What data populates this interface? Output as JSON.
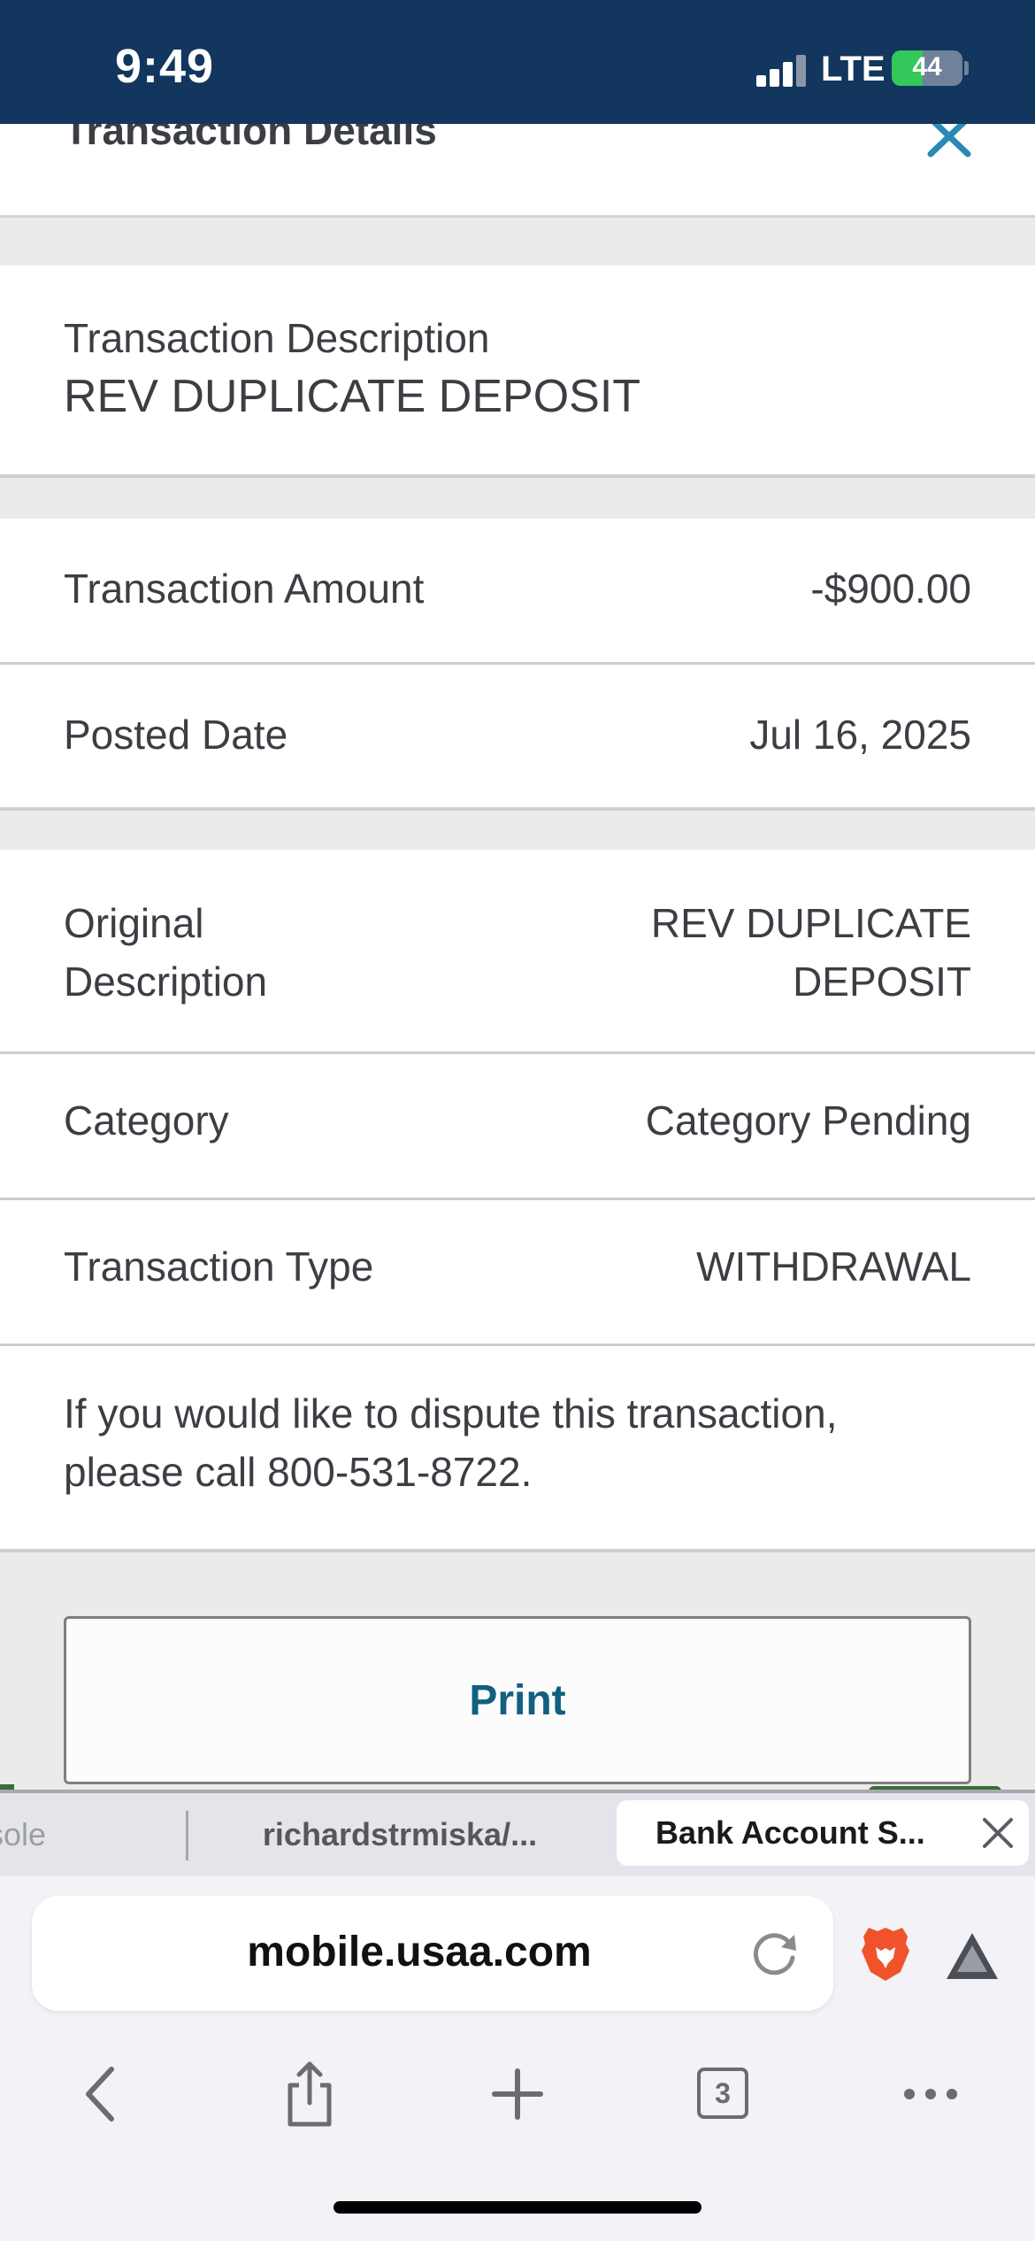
{
  "status_bar": {
    "time": "9:49",
    "network": "LTE",
    "battery_level": "44",
    "battery_percent": 44,
    "signal_bars": 3
  },
  "header": {
    "title": "Transaction Details",
    "close_icon": "close-icon"
  },
  "transaction": {
    "description_label": "Transaction Description",
    "description_value": "REV DUPLICATE DEPOSIT",
    "rows_group1": [
      {
        "label": "Transaction Amount",
        "value": "-$900.00"
      },
      {
        "label": "Posted Date",
        "value": "Jul 16, 2025"
      }
    ],
    "original_description_label_line1": "Original",
    "original_description_label_line2": "Description",
    "original_description_value_line1": "REV DUPLICATE",
    "original_description_value_line2": "DEPOSIT",
    "category_label": "Category",
    "category_value": "Category Pending",
    "type_label": "Transaction Type",
    "type_value": "WITHDRAWAL",
    "dispute_line1": "If you would like to dispute this transaction,",
    "dispute_line2": "please call 800-531-8722."
  },
  "actions": {
    "print_label": "Print"
  },
  "browser": {
    "tabs": [
      {
        "label": "sole",
        "active": false
      },
      {
        "label": "richardstrmiska/...",
        "active": false
      },
      {
        "label": "Bank Account S...",
        "active": true
      }
    ],
    "url": "mobile.usaa.com",
    "tab_count": "3"
  },
  "colors": {
    "status_bar": "#12365e",
    "accent_close": "#2a8ab5",
    "print_text": "#116080",
    "battery_green": "#34c759",
    "brave_orange": "#f0532b"
  }
}
